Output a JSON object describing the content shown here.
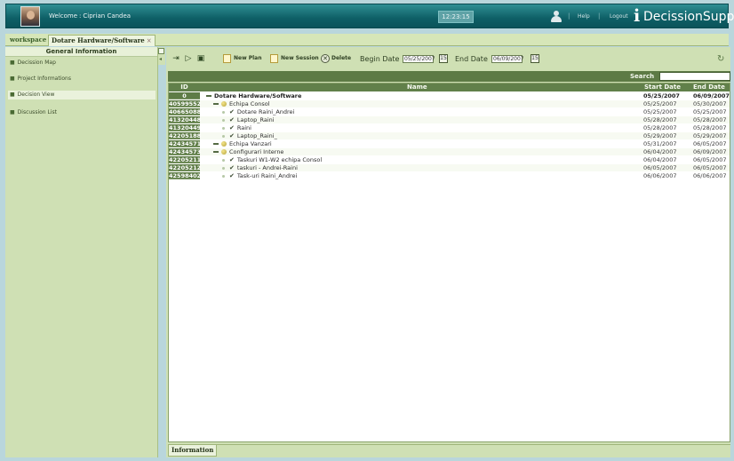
{
  "header": {
    "welcome_label": "Welcome",
    "separator": ":",
    "user_name": "Ciprian Candea",
    "clock": "12:23:15",
    "help_link": "Help",
    "logout_link": "Logout",
    "divider": "|",
    "brand_i": "i",
    "brand_name": "DecissionSupport"
  },
  "tabs": {
    "workspace": "workspace",
    "active": "Dotare Hardware/Software",
    "close_glyph": "×"
  },
  "sidebar": {
    "title": "General Information",
    "items": [
      {
        "label": "Decission Map"
      },
      {
        "label": "Project Informations"
      },
      {
        "label": "Decision View"
      },
      {
        "label": "Discussion List"
      }
    ]
  },
  "toolbar": {
    "new_plan": "New Plan",
    "new_session": "New Session",
    "delete": "Delete",
    "begin_date_label": "Begin Date",
    "begin_date_value": "05/25/2007",
    "end_date_label": "End Date",
    "end_date_value": "06/09/2007",
    "calendar_glyph": "15"
  },
  "search": {
    "label": "Search",
    "value": ""
  },
  "grid": {
    "columns": {
      "id": "ID",
      "name": "Name",
      "start": "Start Date",
      "end": "End Date"
    },
    "rows": [
      {
        "id": "0",
        "name": "Dotare Hardware/Software",
        "start": "05/25/2007",
        "end": "06/09/2007"
      },
      {
        "id": "40599552",
        "name": "Echipa Consol",
        "start": "05/25/2007",
        "end": "05/30/2007"
      },
      {
        "id": "40665088",
        "name": "Dotare Raini_Andrei",
        "start": "05/25/2007",
        "end": "05/25/2007"
      },
      {
        "id": "41320448",
        "name": "Laptop_Raini",
        "start": "05/28/2007",
        "end": "05/28/2007"
      },
      {
        "id": "41320449",
        "name": "Raini",
        "start": "05/28/2007",
        "end": "05/28/2007"
      },
      {
        "id": "42205188",
        "name": "Laptop_Raini_",
        "start": "05/29/2007",
        "end": "05/29/2007"
      },
      {
        "id": "42434571",
        "name": "Echipa Vanzari",
        "start": "05/31/2007",
        "end": "06/05/2007"
      },
      {
        "id": "42434573",
        "name": "Configurari Interne",
        "start": "06/04/2007",
        "end": "06/09/2007"
      },
      {
        "id": "42205211",
        "name": "Taskuri W1-W2 echipa Consol",
        "start": "06/04/2007",
        "end": "06/05/2007"
      },
      {
        "id": "42205212",
        "name": "taskuri - Andrei-Raini",
        "start": "06/05/2007",
        "end": "06/05/2007"
      },
      {
        "id": "42598402",
        "name": "Task-uri Raini_Andrei",
        "start": "06/06/2007",
        "end": "06/06/2007"
      }
    ]
  },
  "bottom_tab": {
    "label": "Information"
  }
}
